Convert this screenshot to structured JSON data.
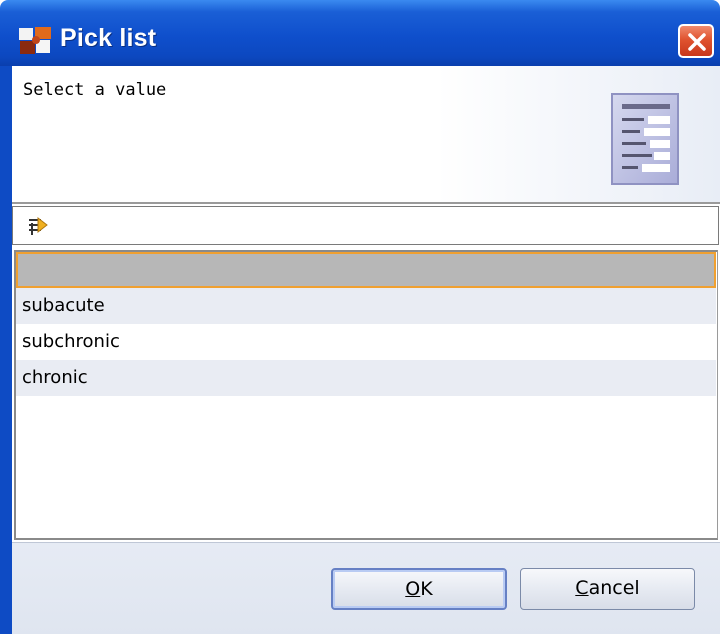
{
  "window": {
    "title": "Pick list",
    "close_icon": "close-icon",
    "app_icon": "app-logo-icon",
    "colors": {
      "titlebar": "#0f4fcc",
      "close": "#e0532f",
      "selection_border": "#f0a030",
      "selection_bg": "#b7b7b7",
      "alt_row": "#e9ecf3"
    }
  },
  "header": {
    "instruction": "Select a value",
    "icon": "list-document-icon"
  },
  "filter": {
    "icon": "filter-icon",
    "value": "",
    "placeholder": ""
  },
  "list": {
    "items": [
      {
        "label": "",
        "selected": true
      },
      {
        "label": "subacute",
        "selected": false
      },
      {
        "label": "subchronic",
        "selected": false
      },
      {
        "label": "chronic",
        "selected": false
      }
    ]
  },
  "buttons": {
    "ok_mnemonic": "O",
    "ok_rest": "K",
    "cancel_mnemonic": "C",
    "cancel_rest": "ancel"
  }
}
